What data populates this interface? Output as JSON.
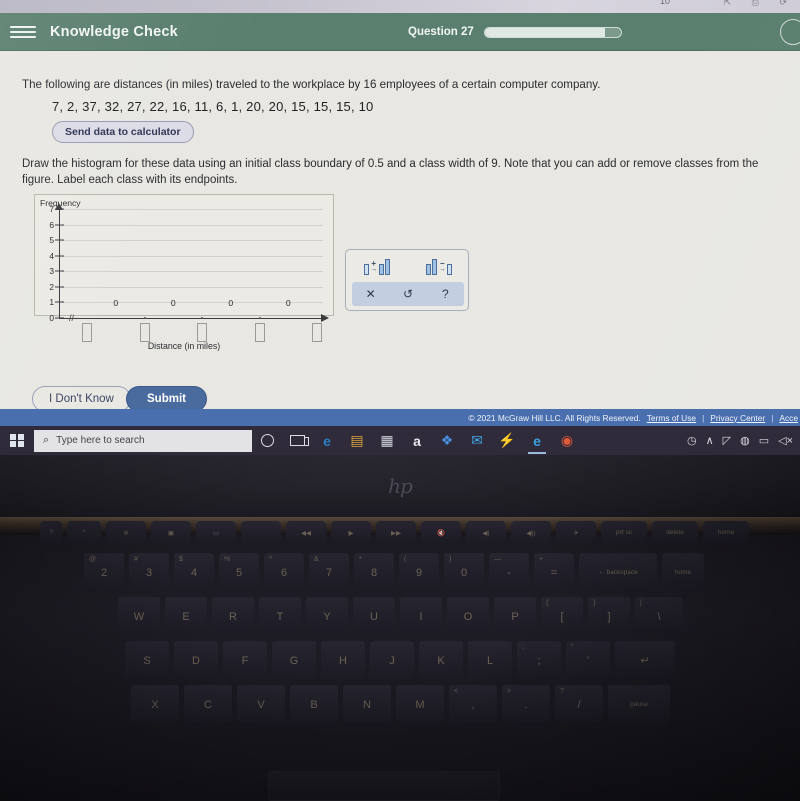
{
  "browser_strip": {
    "zoom_label": "10",
    "icons": "⇱ ⎙ ⟳"
  },
  "header": {
    "menu_icon": "hamburger-icon",
    "title": "Knowledge Check",
    "question_label": "Question 27",
    "progress_percent": 88,
    "bar_color": "#5a7f6e"
  },
  "question": {
    "prompt": "The following are distances (in miles) traveled to the workplace by 16 employees of a certain computer company.",
    "data_values": "7, 2, 37, 32, 27, 22, 16, 11, 6, 1, 20, 20, 15, 15, 15, 10",
    "send_to_calculator_label": "Send data to calculator",
    "instructions": "Draw the histogram for these data using an initial class boundary of 0.5 and a class width of 9. Note that you can add or remove classes from the figure. Label each class with its endpoints."
  },
  "chart_data": {
    "type": "bar",
    "title": "",
    "xlabel": "Distance (in miles)",
    "ylabel": "Frequency",
    "ylim": [
      0,
      7
    ],
    "ytick_labels": [
      "0",
      "1",
      "2",
      "3",
      "4",
      "5",
      "6",
      "7"
    ],
    "grid": true,
    "categories": [
      "",
      "",
      "",
      ""
    ],
    "values": [
      0,
      0,
      0,
      0
    ],
    "bar_value_labels": [
      "0",
      "0",
      "0",
      "0"
    ],
    "endpoint_inputs": [
      "",
      "",
      "",
      "",
      ""
    ],
    "axis_break": "//",
    "legend": ""
  },
  "tool_panel": {
    "add_class_icon": "add-class-icon",
    "remove_class_icon": "remove-class-icon",
    "add_sign": "+",
    "remove_sign": "−",
    "delete_label": "✕",
    "undo_label": "↺",
    "help_label": "?"
  },
  "actions": {
    "dont_know_label": "I Don't Know",
    "submit_label": "Submit",
    "submit_color": "#4a6b9e"
  },
  "footer": {
    "copyright": "© 2021 McGraw Hill LLC. All Rights Reserved.",
    "links": [
      "Terms of Use",
      "Privacy Center",
      "Acce"
    ],
    "separator": "|",
    "bar_color": "#4a6fae"
  },
  "taskbar": {
    "start_label": "start-button",
    "search_placeholder": "Type here to search",
    "search_value": "",
    "cortana_icon": "circle-icon",
    "taskview_icon": "task-view-icon",
    "apps": [
      {
        "name": "edge-icon",
        "glyph": "e",
        "color": "#2a7fc4"
      },
      {
        "name": "file-explorer-icon",
        "glyph": "▤",
        "color": "#d9a23c"
      },
      {
        "name": "store-icon",
        "glyph": "▦",
        "color": "#cfd3dc"
      },
      {
        "name": "amazon-icon",
        "glyph": "a",
        "color": "#e8e8ea"
      },
      {
        "name": "dropbox-icon",
        "glyph": "❖",
        "color": "#4a8ee0"
      },
      {
        "name": "mail-icon",
        "glyph": "✉",
        "color": "#3fa7e8"
      },
      {
        "name": "lightning-icon",
        "glyph": "⚡",
        "color": "#4a7fd4"
      },
      {
        "name": "internet-explorer-icon",
        "glyph": "e",
        "color": "#3aa0e0"
      },
      {
        "name": "chrome-icon",
        "glyph": "◉",
        "color": "#e05a3a"
      }
    ],
    "tray": [
      "◷",
      "∧",
      "◸",
      "◍",
      "▭",
      "◁×"
    ]
  },
  "laptop": {
    "brand": "hp",
    "keyboard_rows": [
      {
        "keys": [
          {
            "top": "",
            "label": "?",
            "w": 22,
            "cls": "small"
          },
          {
            "top": "",
            "label": "*",
            "w": 34,
            "cls": "small"
          },
          {
            "top": "",
            "label": "※",
            "w": 40,
            "cls": "small"
          },
          {
            "top": "",
            "label": "▣",
            "w": 40,
            "cls": "small"
          },
          {
            "top": "",
            "label": "▭",
            "w": 40,
            "cls": "small"
          },
          {
            "top": "",
            "label": "",
            "w": 40,
            "cls": "small"
          },
          {
            "top": "",
            "label": "◀◀",
            "w": 40,
            "cls": "small"
          },
          {
            "top": "",
            "label": "▶",
            "w": 40,
            "cls": "small"
          },
          {
            "top": "",
            "label": "▶▶",
            "w": 40,
            "cls": "small"
          },
          {
            "top": "",
            "label": "🔇",
            "w": 40,
            "cls": "small"
          },
          {
            "top": "",
            "label": "◀)",
            "w": 40,
            "cls": "small"
          },
          {
            "top": "",
            "label": "◀))",
            "w": 40,
            "cls": "small"
          },
          {
            "top": "",
            "label": "✈",
            "w": 40,
            "cls": "small"
          },
          {
            "top": "",
            "label": "prt sc",
            "w": 46,
            "cls": "small"
          },
          {
            "top": "",
            "label": "delete",
            "w": 46,
            "cls": "small"
          },
          {
            "top": "",
            "label": "home",
            "w": 46,
            "cls": "small"
          }
        ]
      },
      {
        "keys": [
          {
            "top": "@",
            "label": "2",
            "w": 40,
            "cls": ""
          },
          {
            "top": "#",
            "label": "3",
            "w": 40,
            "cls": ""
          },
          {
            "top": "$",
            "label": "4",
            "w": 40,
            "cls": ""
          },
          {
            "top": "%",
            "label": "5",
            "w": 40,
            "cls": ""
          },
          {
            "top": "^",
            "label": "6",
            "w": 40,
            "cls": ""
          },
          {
            "top": "&",
            "label": "7",
            "w": 40,
            "cls": ""
          },
          {
            "top": "*",
            "label": "8",
            "w": 40,
            "cls": ""
          },
          {
            "top": "(",
            "label": "9",
            "w": 40,
            "cls": ""
          },
          {
            "top": ")",
            "label": "0",
            "w": 40,
            "cls": ""
          },
          {
            "top": "—",
            "label": "-",
            "w": 40,
            "cls": ""
          },
          {
            "top": "+",
            "label": "=",
            "w": 40,
            "cls": ""
          },
          {
            "top": "",
            "label": "← backspace",
            "w": 78,
            "cls": "wide"
          },
          {
            "top": "",
            "label": "home",
            "w": 42,
            "cls": "small"
          }
        ]
      },
      {
        "keys": [
          {
            "top": "",
            "label": "W",
            "w": 42,
            "cls": ""
          },
          {
            "top": "",
            "label": "E",
            "w": 42,
            "cls": ""
          },
          {
            "top": "",
            "label": "R",
            "w": 42,
            "cls": ""
          },
          {
            "top": "",
            "label": "T",
            "w": 42,
            "cls": ""
          },
          {
            "top": "",
            "label": "Y",
            "w": 42,
            "cls": ""
          },
          {
            "top": "",
            "label": "U",
            "w": 42,
            "cls": ""
          },
          {
            "top": "",
            "label": "I",
            "w": 42,
            "cls": ""
          },
          {
            "top": "",
            "label": "O",
            "w": 42,
            "cls": ""
          },
          {
            "top": "",
            "label": "P",
            "w": 42,
            "cls": ""
          },
          {
            "top": "{",
            "label": "[",
            "w": 42,
            "cls": ""
          },
          {
            "top": "}",
            "label": "]",
            "w": 42,
            "cls": ""
          },
          {
            "top": "|",
            "label": "\\",
            "w": 48,
            "cls": ""
          }
        ]
      },
      {
        "keys": [
          {
            "top": "",
            "label": "S",
            "w": 44,
            "cls": ""
          },
          {
            "top": "",
            "label": "D",
            "w": 44,
            "cls": ""
          },
          {
            "top": "",
            "label": "F",
            "w": 44,
            "cls": ""
          },
          {
            "top": "",
            "label": "G",
            "w": 44,
            "cls": ""
          },
          {
            "top": "",
            "label": "H",
            "w": 44,
            "cls": ""
          },
          {
            "top": "",
            "label": "J",
            "w": 44,
            "cls": ""
          },
          {
            "top": "",
            "label": "K",
            "w": 44,
            "cls": ""
          },
          {
            "top": "",
            "label": "L",
            "w": 44,
            "cls": ""
          },
          {
            "top": ":",
            "label": ";",
            "w": 44,
            "cls": ""
          },
          {
            "top": "\"",
            "label": "'",
            "w": 44,
            "cls": ""
          },
          {
            "top": "",
            "label": "↵",
            "w": 60,
            "cls": ""
          }
        ]
      },
      {
        "keys": [
          {
            "top": "",
            "label": "X",
            "w": 48,
            "cls": ""
          },
          {
            "top": "",
            "label": "C",
            "w": 48,
            "cls": ""
          },
          {
            "top": "",
            "label": "V",
            "w": 48,
            "cls": ""
          },
          {
            "top": "",
            "label": "B",
            "w": 48,
            "cls": ""
          },
          {
            "top": "",
            "label": "N",
            "w": 48,
            "cls": ""
          },
          {
            "top": "",
            "label": "M",
            "w": 48,
            "cls": ""
          },
          {
            "top": "<",
            "label": ",",
            "w": 48,
            "cls": ""
          },
          {
            "top": ">",
            "label": ".",
            "w": 48,
            "cls": ""
          },
          {
            "top": "?",
            "label": "/",
            "w": 48,
            "cls": ""
          },
          {
            "top": "",
            "label": "pause",
            "w": 62,
            "cls": "small"
          }
        ]
      }
    ]
  }
}
